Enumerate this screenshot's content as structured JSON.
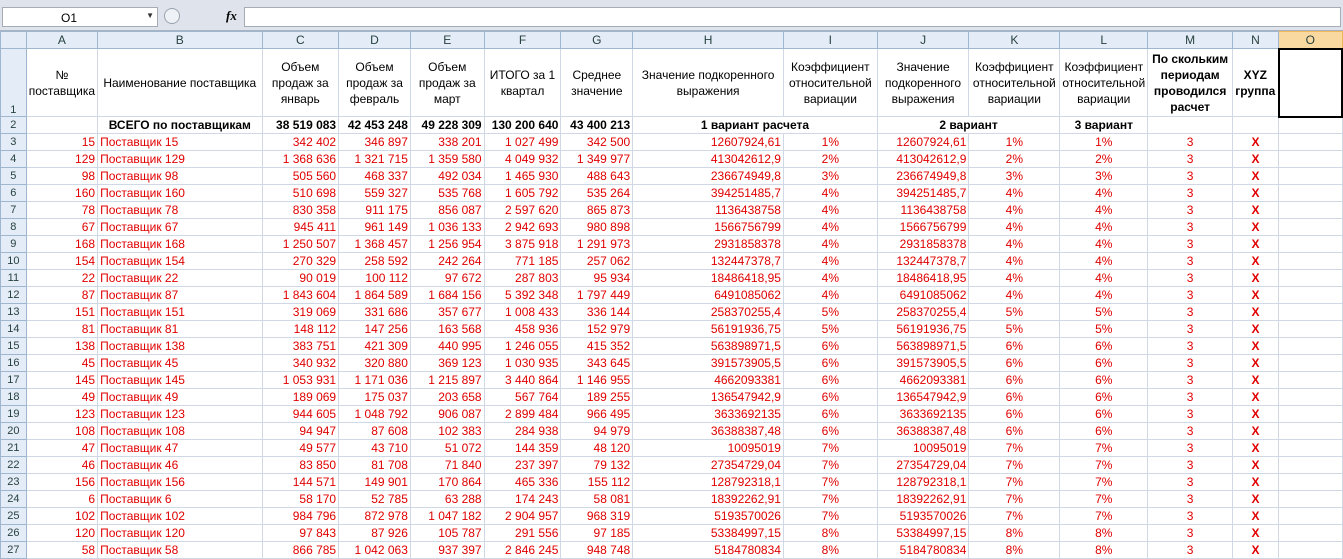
{
  "name_box": "O1",
  "fx_label": "fx",
  "columns": [
    "A",
    "B",
    "C",
    "D",
    "E",
    "F",
    "G",
    "H",
    "I",
    "J",
    "K",
    "L",
    "M",
    "N",
    "O"
  ],
  "header_row_num": "1",
  "headers": [
    "№ поставщика",
    "Наименование поставщика",
    "Объем продаж за январь",
    "Объем продаж за февраль",
    "Объем продаж за март",
    "ИТОГО за 1 квартал",
    "Среднее значение",
    "Значение подкоренного выражения",
    "Коэффициент относительной вариации",
    "Значение подкоренного выражения",
    "Коэффициент относительной вариации",
    "Коэффициент относительной вариации",
    "По скольким периодам проводился расчет",
    "XYZ группа",
    ""
  ],
  "total_row": {
    "row_num": "2",
    "label": "ВСЕГО по поставщикам",
    "jan": "38 519 083",
    "feb": "42 453 248",
    "mar": "49 228 309",
    "q1": "130 200 640",
    "avg": "43 400 213",
    "variant1": "1 вариант расчета",
    "variant2": "2 вариант",
    "variant3": "3 вариант"
  },
  "rows": [
    {
      "r": "3",
      "id": "15",
      "name": "Поставщик 15",
      "jan": "342 402",
      "feb": "346 897",
      "mar": "338 201",
      "q1": "1 027 499",
      "avg": "342 500",
      "v1": "12607924,61",
      "c1": "1%",
      "v2": "12607924,61",
      "c2": "1%",
      "c3": "1%",
      "m": "3",
      "x": "X"
    },
    {
      "r": "4",
      "id": "129",
      "name": "Поставщик 129",
      "jan": "1 368 636",
      "feb": "1 321 715",
      "mar": "1 359 580",
      "q1": "4 049 932",
      "avg": "1 349 977",
      "v1": "413042612,9",
      "c1": "2%",
      "v2": "413042612,9",
      "c2": "2%",
      "c3": "2%",
      "m": "3",
      "x": "X"
    },
    {
      "r": "5",
      "id": "98",
      "name": "Поставщик 98",
      "jan": "505 560",
      "feb": "468 337",
      "mar": "492 034",
      "q1": "1 465 930",
      "avg": "488 643",
      "v1": "236674949,8",
      "c1": "3%",
      "v2": "236674949,8",
      "c2": "3%",
      "c3": "3%",
      "m": "3",
      "x": "X"
    },
    {
      "r": "6",
      "id": "160",
      "name": "Поставщик 160",
      "jan": "510 698",
      "feb": "559 327",
      "mar": "535 768",
      "q1": "1 605 792",
      "avg": "535 264",
      "v1": "394251485,7",
      "c1": "4%",
      "v2": "394251485,7",
      "c2": "4%",
      "c3": "4%",
      "m": "3",
      "x": "X"
    },
    {
      "r": "7",
      "id": "78",
      "name": "Поставщик 78",
      "jan": "830 358",
      "feb": "911 175",
      "mar": "856 087",
      "q1": "2 597 620",
      "avg": "865 873",
      "v1": "1136438758",
      "c1": "4%",
      "v2": "1136438758",
      "c2": "4%",
      "c3": "4%",
      "m": "3",
      "x": "X"
    },
    {
      "r": "8",
      "id": "67",
      "name": "Поставщик 67",
      "jan": "945 411",
      "feb": "961 149",
      "mar": "1 036 133",
      "q1": "2 942 693",
      "avg": "980 898",
      "v1": "1566756799",
      "c1": "4%",
      "v2": "1566756799",
      "c2": "4%",
      "c3": "4%",
      "m": "3",
      "x": "X"
    },
    {
      "r": "9",
      "id": "168",
      "name": "Поставщик 168",
      "jan": "1 250 507",
      "feb": "1 368 457",
      "mar": "1 256 954",
      "q1": "3 875 918",
      "avg": "1 291 973",
      "v1": "2931858378",
      "c1": "4%",
      "v2": "2931858378",
      "c2": "4%",
      "c3": "4%",
      "m": "3",
      "x": "X"
    },
    {
      "r": "10",
      "id": "154",
      "name": "Поставщик 154",
      "jan": "270 329",
      "feb": "258 592",
      "mar": "242 264",
      "q1": "771 185",
      "avg": "257 062",
      "v1": "132447378,7",
      "c1": "4%",
      "v2": "132447378,7",
      "c2": "4%",
      "c3": "4%",
      "m": "3",
      "x": "X"
    },
    {
      "r": "11",
      "id": "22",
      "name": "Поставщик 22",
      "jan": "90 019",
      "feb": "100 112",
      "mar": "97 672",
      "q1": "287 803",
      "avg": "95 934",
      "v1": "18486418,95",
      "c1": "4%",
      "v2": "18486418,95",
      "c2": "4%",
      "c3": "4%",
      "m": "3",
      "x": "X"
    },
    {
      "r": "12",
      "id": "87",
      "name": "Поставщик 87",
      "jan": "1 843 604",
      "feb": "1 864 589",
      "mar": "1 684 156",
      "q1": "5 392 348",
      "avg": "1 797 449",
      "v1": "6491085062",
      "c1": "4%",
      "v2": "6491085062",
      "c2": "4%",
      "c3": "4%",
      "m": "3",
      "x": "X"
    },
    {
      "r": "13",
      "id": "151",
      "name": "Поставщик 151",
      "jan": "319 069",
      "feb": "331 686",
      "mar": "357 677",
      "q1": "1 008 433",
      "avg": "336 144",
      "v1": "258370255,4",
      "c1": "5%",
      "v2": "258370255,4",
      "c2": "5%",
      "c3": "5%",
      "m": "3",
      "x": "X"
    },
    {
      "r": "14",
      "id": "81",
      "name": "Поставщик 81",
      "jan": "148 112",
      "feb": "147 256",
      "mar": "163 568",
      "q1": "458 936",
      "avg": "152 979",
      "v1": "56191936,75",
      "c1": "5%",
      "v2": "56191936,75",
      "c2": "5%",
      "c3": "5%",
      "m": "3",
      "x": "X"
    },
    {
      "r": "15",
      "id": "138",
      "name": "Поставщик 138",
      "jan": "383 751",
      "feb": "421 309",
      "mar": "440 995",
      "q1": "1 246 055",
      "avg": "415 352",
      "v1": "563898971,5",
      "c1": "6%",
      "v2": "563898971,5",
      "c2": "6%",
      "c3": "6%",
      "m": "3",
      "x": "X"
    },
    {
      "r": "16",
      "id": "45",
      "name": "Поставщик 45",
      "jan": "340 932",
      "feb": "320 880",
      "mar": "369 123",
      "q1": "1 030 935",
      "avg": "343 645",
      "v1": "391573905,5",
      "c1": "6%",
      "v2": "391573905,5",
      "c2": "6%",
      "c3": "6%",
      "m": "3",
      "x": "X"
    },
    {
      "r": "17",
      "id": "145",
      "name": "Поставщик 145",
      "jan": "1 053 931",
      "feb": "1 171 036",
      "mar": "1 215 897",
      "q1": "3 440 864",
      "avg": "1 146 955",
      "v1": "4662093381",
      "c1": "6%",
      "v2": "4662093381",
      "c2": "6%",
      "c3": "6%",
      "m": "3",
      "x": "X"
    },
    {
      "r": "18",
      "id": "49",
      "name": "Поставщик 49",
      "jan": "189 069",
      "feb": "175 037",
      "mar": "203 658",
      "q1": "567 764",
      "avg": "189 255",
      "v1": "136547942,9",
      "c1": "6%",
      "v2": "136547942,9",
      "c2": "6%",
      "c3": "6%",
      "m": "3",
      "x": "X"
    },
    {
      "r": "19",
      "id": "123",
      "name": "Поставщик 123",
      "jan": "944 605",
      "feb": "1 048 792",
      "mar": "906 087",
      "q1": "2 899 484",
      "avg": "966 495",
      "v1": "3633692135",
      "c1": "6%",
      "v2": "3633692135",
      "c2": "6%",
      "c3": "6%",
      "m": "3",
      "x": "X"
    },
    {
      "r": "20",
      "id": "108",
      "name": "Поставщик 108",
      "jan": "94 947",
      "feb": "87 608",
      "mar": "102 383",
      "q1": "284 938",
      "avg": "94 979",
      "v1": "36388387,48",
      "c1": "6%",
      "v2": "36388387,48",
      "c2": "6%",
      "c3": "6%",
      "m": "3",
      "x": "X"
    },
    {
      "r": "21",
      "id": "47",
      "name": "Поставщик 47",
      "jan": "49 577",
      "feb": "43 710",
      "mar": "51 072",
      "q1": "144 359",
      "avg": "48 120",
      "v1": "10095019",
      "c1": "7%",
      "v2": "10095019",
      "c2": "7%",
      "c3": "7%",
      "m": "3",
      "x": "X"
    },
    {
      "r": "22",
      "id": "46",
      "name": "Поставщик 46",
      "jan": "83 850",
      "feb": "81 708",
      "mar": "71 840",
      "q1": "237 397",
      "avg": "79 132",
      "v1": "27354729,04",
      "c1": "7%",
      "v2": "27354729,04",
      "c2": "7%",
      "c3": "7%",
      "m": "3",
      "x": "X"
    },
    {
      "r": "23",
      "id": "156",
      "name": "Поставщик 156",
      "jan": "144 571",
      "feb": "149 901",
      "mar": "170 864",
      "q1": "465 336",
      "avg": "155 112",
      "v1": "128792318,1",
      "c1": "7%",
      "v2": "128792318,1",
      "c2": "7%",
      "c3": "7%",
      "m": "3",
      "x": "X"
    },
    {
      "r": "24",
      "id": "6",
      "name": "Поставщик 6",
      "jan": "58 170",
      "feb": "52 785",
      "mar": "63 288",
      "q1": "174 243",
      "avg": "58 081",
      "v1": "18392262,91",
      "c1": "7%",
      "v2": "18392262,91",
      "c2": "7%",
      "c3": "7%",
      "m": "3",
      "x": "X"
    },
    {
      "r": "25",
      "id": "102",
      "name": "Поставщик 102",
      "jan": "984 796",
      "feb": "872 978",
      "mar": "1 047 182",
      "q1": "2 904 957",
      "avg": "968 319",
      "v1": "5193570026",
      "c1": "7%",
      "v2": "5193570026",
      "c2": "7%",
      "c3": "7%",
      "m": "3",
      "x": "X"
    },
    {
      "r": "26",
      "id": "120",
      "name": "Поставщик 120",
      "jan": "97 843",
      "feb": "87 926",
      "mar": "105 787",
      "q1": "291 556",
      "avg": "97 185",
      "v1": "53384997,15",
      "c1": "8%",
      "v2": "53384997,15",
      "c2": "8%",
      "c3": "8%",
      "m": "3",
      "x": "X"
    },
    {
      "r": "27",
      "id": "58",
      "name": "Поставщик 58",
      "jan": "866 785",
      "feb": "1 042 063",
      "mar": "937 397",
      "q1": "2 846 245",
      "avg": "948 748",
      "v1": "5184780834",
      "c1": "8%",
      "v2": "5184780834",
      "c2": "8%",
      "c3": "8%",
      "m": "3",
      "x": "X"
    }
  ]
}
